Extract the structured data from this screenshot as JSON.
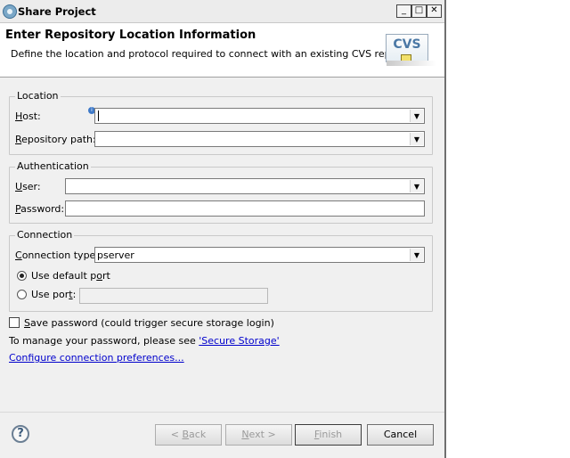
{
  "window": {
    "title": "Share Project",
    "controls": {
      "minimize": "_",
      "maximize": "□",
      "close": "✕"
    }
  },
  "header": {
    "title": "Enter Repository Location Information",
    "description": "Define the location and protocol required to connect with an existing CVS repository.",
    "logo_text": "CVS"
  },
  "location": {
    "group_label": "Location",
    "host_label": "Host:",
    "host_value": "",
    "repo_path_label": "Repository path:",
    "repo_path_value": ""
  },
  "authentication": {
    "group_label": "Authentication",
    "user_label": "User:",
    "user_value": "",
    "password_label": "Password:",
    "password_value": ""
  },
  "connection": {
    "group_label": "Connection",
    "type_label": "Connection type:",
    "type_value": "pserver",
    "default_port_label": "Use default port",
    "default_port_selected": true,
    "use_port_label": "Use port:",
    "port_value": ""
  },
  "save_password": {
    "label": "Save password (could trigger secure storage login)",
    "checked": false
  },
  "secure_storage_text": "To manage your password, please see ",
  "secure_storage_link": "'Secure Storage'",
  "configure_link": "Configure connection preferences...",
  "buttons": {
    "back": "< Back",
    "next": "Next >",
    "finish": "Finish",
    "cancel": "Cancel",
    "help": "?"
  },
  "colors": {
    "link": "#0000cc",
    "disabled_text": "#9a9a9a"
  },
  "icons": [
    "share-project-icon",
    "info-icon",
    "help-icon",
    "dropdown-arrow-icon"
  ]
}
